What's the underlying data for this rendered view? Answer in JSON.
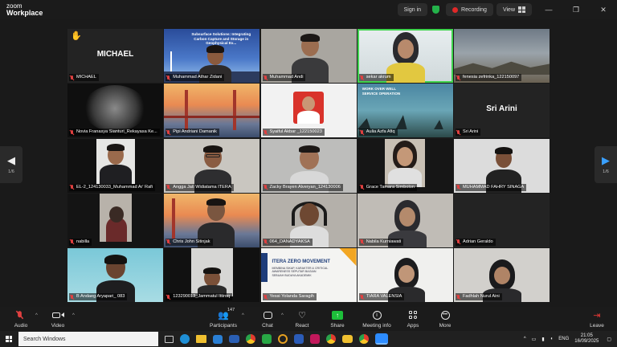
{
  "window": {
    "brand_line1": "zoom",
    "brand_line2": "Workplace",
    "sign_in": "Sign in",
    "recording": "Recording",
    "view": "View",
    "minimize_glyph": "—",
    "maximize_glyph": "❐",
    "close_glyph": "✕"
  },
  "colors": {
    "active_speaker": "#3fd44e",
    "recording": "#e02828",
    "share": "#1dbf3a",
    "leave": "#e53935",
    "page_arrow": "#3aa0ff"
  },
  "participants": [
    {
      "name": "MICHAEL",
      "display": "MICHAEL",
      "hand": "✋"
    },
    {
      "name": "Muhammad Athar Zidani"
    },
    {
      "name": "Muhammad Andi"
    },
    {
      "name": "sekar akrum",
      "active": true
    },
    {
      "name": "fenesia zefrinka_122150097"
    },
    {
      "name": "Novia Franasya Sianturi_Rekayasa Ke..."
    },
    {
      "name": "Pipi Andriani Damanik"
    },
    {
      "name": "Syaiful Akbar _122150023"
    },
    {
      "name": "Aulia Azfa Afiq"
    },
    {
      "name": "Sri Arini",
      "display": "Sri Arini"
    },
    {
      "name": "EL-2_124130033_Muhammad Ar' Rafi"
    },
    {
      "name": "Angga Jati Widiatama ITERA"
    },
    {
      "name": "Zacky Brayen Alveryan_124130006"
    },
    {
      "name": "Grace Tamara Simbolon"
    },
    {
      "name": "MUHAMMAD FAHRY SINAGA"
    },
    {
      "name": "nabilla"
    },
    {
      "name": "Chris John Sitinjak"
    },
    {
      "name": "064_DANADYAKSA"
    },
    {
      "name": "Nabila Kurniawati"
    },
    {
      "name": "Adrian Geraldo"
    },
    {
      "name": "B Andaeg Aryapari_ 083"
    },
    {
      "name": "123290013_Jammatul Ittiroq"
    },
    {
      "name": "Yessi Yolanda Saragih"
    },
    {
      "name": "TIARA VALENSIA"
    },
    {
      "name": "Fadhlah Nurul Aini"
    }
  ],
  "tile_text": {
    "slide_title": "Subsurface Solutions: Integrating Carbon Capture and Storage in Geophysical Ex...",
    "wow_title": "WORK OVER WELL SERVICE OPERATION",
    "itera_title": "ITERA ZERO MOVEMENT",
    "itera_sub": "MEMBINA SIKAP, KARAKTER & CRITICAL AWARENESS SEPUTAR BAGIAN SEBUAH BUDAYA AKADEMIK"
  },
  "paging": {
    "left_glyph": "◀",
    "right_glyph": "▶",
    "left_page": "1/6",
    "right_page": "1/6"
  },
  "toolbar": {
    "audio": "Audio",
    "video": "Video",
    "participants": "Participants",
    "participants_count": "147",
    "chat": "Chat",
    "react": "React",
    "share": "Share",
    "meeting_info": "Meeting info",
    "apps": "Apps",
    "more": "More",
    "leave": "Leave",
    "caret": "^"
  },
  "taskbar": {
    "search_placeholder": "Search Windows",
    "lang": "ENG",
    "time": "21:05",
    "date": "16/09/2025"
  }
}
